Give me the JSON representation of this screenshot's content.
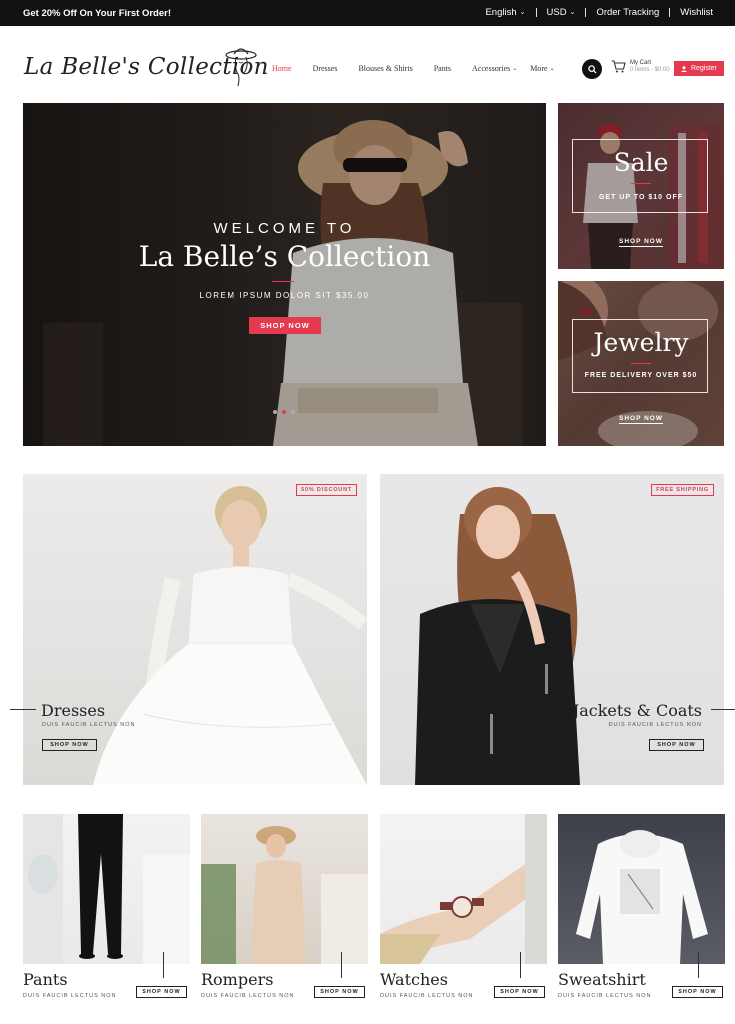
{
  "topbar": {
    "promo": "Get 20% Off On Your First Order!",
    "language": "English",
    "currency": "USD",
    "order_tracking": "Order Tracking",
    "wishlist": "Wishlist"
  },
  "header": {
    "logo": "La Belle's Collection",
    "nav": [
      "Home",
      "Dresses",
      "Blouses & Shirts",
      "Pants",
      "Accessories",
      "More"
    ],
    "cart_label": "My Cart",
    "cart_sub": "0 items - $0.00",
    "register": "Register"
  },
  "hero": {
    "welcome": "WELCOME TO",
    "title": "La Belle’s Collection",
    "subtitle": "LOREM IPSUM DOLOR SIT $35.00",
    "button": "SHOP NOW"
  },
  "promos": {
    "sale": {
      "title": "Sale",
      "subtitle": "GET UP TO $10 OFF",
      "button": "SHOP NOW"
    },
    "jewelry": {
      "title": "Jewelry",
      "subtitle": "FREE DELIVERY OVER $50",
      "button": "SHOP NOW"
    }
  },
  "mid": {
    "dresses": {
      "badge": "50% DISCOUNT",
      "title": "Dresses",
      "subtitle": "DUIS FAUCIB LECTUS NON",
      "button": "SHOP NOW"
    },
    "jackets": {
      "badge": "FREE SHIPPING",
      "title": "Jackets & Coats",
      "subtitle": "DUIS FAUCIB LECTUS NON",
      "button": "SHOP NOW"
    }
  },
  "bottom": [
    {
      "title": "Pants",
      "subtitle": "DUIS FAUCIB LECTUS NON",
      "button": "SHOP NOW"
    },
    {
      "title": "Rompers",
      "subtitle": "DUIS FAUCIB LECTUS NON",
      "button": "SHOP NOW"
    },
    {
      "title": "Watches",
      "subtitle": "DUIS FAUCIB LECTUS NON",
      "button": "SHOP NOW"
    },
    {
      "title": "Sweatshirt",
      "subtitle": "DUIS FAUCIB LECTUS NON",
      "button": "SHOP NOW"
    }
  ],
  "colors": {
    "accent": "#e4394f",
    "topbar": "#111111"
  },
  "icons": [
    "chevron-down-icon",
    "search-icon",
    "cart-icon",
    "user-icon",
    "hat-woman-icon"
  ]
}
